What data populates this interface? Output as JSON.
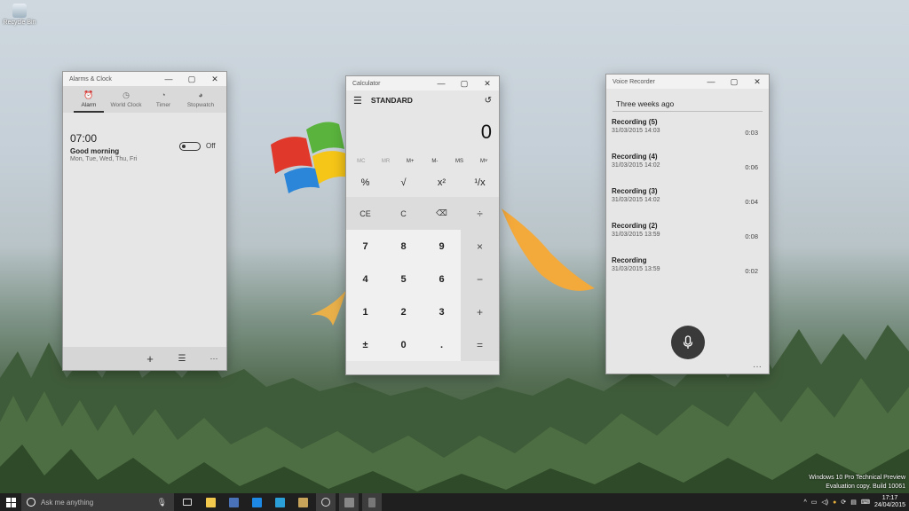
{
  "desktop": {
    "icon_label": "Recycle Bin"
  },
  "alarms": {
    "title": "Alarms & Clock",
    "tabs": [
      {
        "label": "Alarm",
        "icon": "alarm-icon"
      },
      {
        "label": "World Clock",
        "icon": "world-clock-icon"
      },
      {
        "label": "Timer",
        "icon": "timer-icon"
      },
      {
        "label": "Stopwatch",
        "icon": "stopwatch-icon"
      }
    ],
    "alarm": {
      "time": "07:00",
      "name": "Good morning",
      "days": "Mon, Tue, Wed, Thu, Fri",
      "toggle_label": "Off"
    }
  },
  "calculator": {
    "title": "Calculator",
    "mode": "STANDARD",
    "display": "0",
    "memory": [
      "MC",
      "MR",
      "M+",
      "M-",
      "MS",
      "M˅"
    ],
    "rows": [
      [
        "%",
        "√",
        "x²",
        "¹/x"
      ],
      [
        "CE",
        "C",
        "⌫",
        "÷"
      ],
      [
        "7",
        "8",
        "9",
        "×"
      ],
      [
        "4",
        "5",
        "6",
        "−"
      ],
      [
        "1",
        "2",
        "3",
        "+"
      ],
      [
        "±",
        "0",
        ".",
        "="
      ]
    ]
  },
  "voice": {
    "title": "Voice Recorder",
    "group": "Three weeks ago",
    "recordings": [
      {
        "name": "Recording (5)",
        "date": "31/03/2015 14:03",
        "duration": "0:03"
      },
      {
        "name": "Recording (4)",
        "date": "31/03/2015 14:02",
        "duration": "0:06"
      },
      {
        "name": "Recording (3)",
        "date": "31/03/2015 14:02",
        "duration": "0:04"
      },
      {
        "name": "Recording (2)",
        "date": "31/03/2015 13:59",
        "duration": "0:08"
      },
      {
        "name": "Recording",
        "date": "31/03/2015 13:59",
        "duration": "0:02"
      }
    ]
  },
  "watermark": {
    "line1": "Windows 10 Pro Technical Preview",
    "line2": "Evaluation copy. Build 10061"
  },
  "taskbar": {
    "search_placeholder": "Ask me anything",
    "time": "17:17",
    "date": "24/04/2015"
  }
}
